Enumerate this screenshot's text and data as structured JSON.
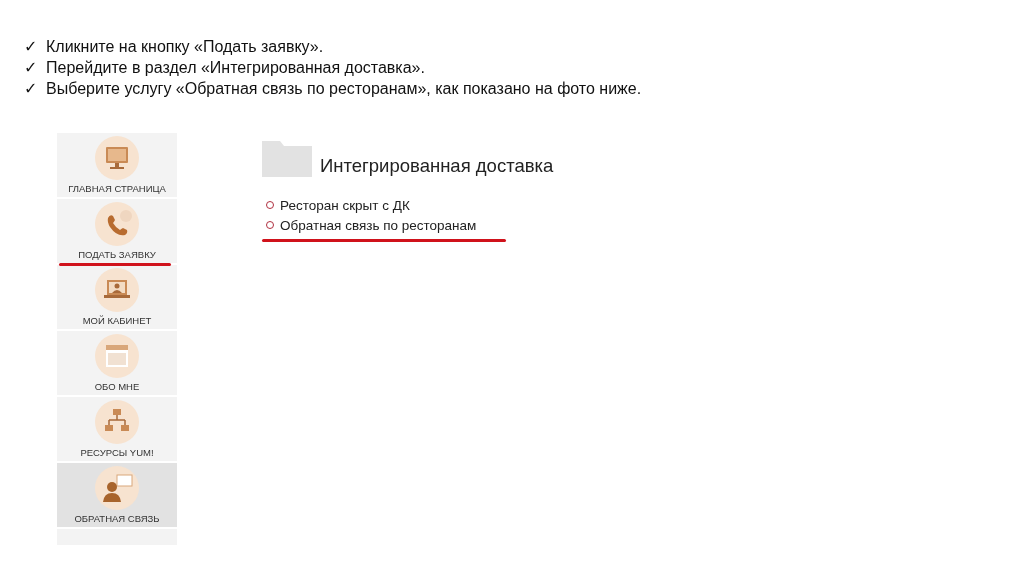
{
  "instructions": [
    {
      "mark": "✓",
      "text": "Кликните на кнопку «Подать заявку»."
    },
    {
      "mark": "✓",
      "text": "Перейдите в раздел «Интегрированная доставка»."
    },
    {
      "mark": "✓",
      "text": "Выберите услугу «Обратная связь по ресторанам», как показано на фото ниже."
    }
  ],
  "sidebar": {
    "items": [
      {
        "label": "ГЛАВНАЯ СТРАНИЦА",
        "selected": false,
        "underlined": false
      },
      {
        "label": "ПОДАТЬ ЗАЯВКУ",
        "selected": false,
        "underlined": true
      },
      {
        "label": "МОЙ КАБИНЕТ",
        "selected": false,
        "underlined": false
      },
      {
        "label": "ОБО МНЕ",
        "selected": false,
        "underlined": false
      },
      {
        "label": "РЕСУРСЫ YUM!",
        "selected": false,
        "underlined": false
      },
      {
        "label": "ОБРАТНАЯ СВЯЗЬ",
        "selected": true,
        "underlined": false
      }
    ]
  },
  "section": {
    "title": "Интегрированная доставка",
    "services": [
      {
        "label": "Ресторан скрыт с ДК",
        "underlined": false
      },
      {
        "label": "Обратная связь по ресторанам",
        "underlined": true
      }
    ]
  }
}
